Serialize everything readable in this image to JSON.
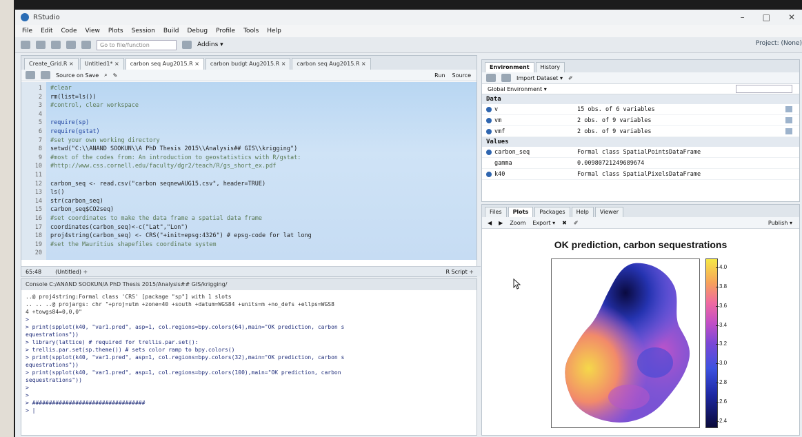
{
  "window": {
    "title": "RStudio",
    "controls": [
      "–",
      "□",
      "✕"
    ]
  },
  "menu": [
    "File",
    "Edit",
    "Code",
    "View",
    "Plots",
    "Session",
    "Build",
    "Debug",
    "Profile",
    "Tools",
    "Help"
  ],
  "toolbar": {
    "goto_placeholder": "Go to file/function",
    "addins": "Addins ▾",
    "project": "Project: (None)"
  },
  "editor": {
    "tabs": [
      "Create_Grid.R ×",
      "Untitled1* ×",
      "carbon seq Aug2015.R ×",
      "carbon budgt Aug2015.R ×",
      "carbon seq Aug2015.R ×"
    ],
    "source_on_save": "Source on Save",
    "run": "Run",
    "source": "Source",
    "lines": [
      {
        "n": "1",
        "t": "#clear",
        "k": "comment"
      },
      {
        "n": "2",
        "t": "rm(list=ls())",
        "k": "plain"
      },
      {
        "n": "3",
        "t": "#control, clear workspace",
        "k": "comment"
      },
      {
        "n": "4",
        "t": "",
        "k": "plain"
      },
      {
        "n": "5",
        "t": "require(sp)",
        "k": "kw"
      },
      {
        "n": "6",
        "t": "require(gstat)",
        "k": "kw"
      },
      {
        "n": "7",
        "t": "#set your own working directory",
        "k": "comment"
      },
      {
        "n": "8",
        "t": "setwd(\"C:\\\\ANAND SOOKUN\\\\A PhD Thesis 2015\\\\Analysis## GIS\\\\krigging\")",
        "k": "plain"
      },
      {
        "n": "9",
        "t": "#most of the codes from: An introduction to geostatistics with R/gstat:",
        "k": "comment"
      },
      {
        "n": "10",
        "t": "#http://www.css.cornell.edu/faculty/dgr2/teach/R/gs_short_ex.pdf",
        "k": "comment"
      },
      {
        "n": "11",
        "t": "",
        "k": "plain"
      },
      {
        "n": "12",
        "t": "carbon_seq <- read.csv(\"carbon seqnewAUG15.csv\", header=TRUE)",
        "k": "plain"
      },
      {
        "n": "13",
        "t": "ls()",
        "k": "plain"
      },
      {
        "n": "14",
        "t": "str(carbon_seq)",
        "k": "plain"
      },
      {
        "n": "15",
        "t": "carbon_seq$CO2seq)",
        "k": "plain"
      },
      {
        "n": "16",
        "t": "#set coordinates to make the data frame a spatial data frame",
        "k": "comment"
      },
      {
        "n": "17",
        "t": "coordinates(carbon_seq)<-c(\"Lat\",\"Lon\")",
        "k": "plain"
      },
      {
        "n": "18",
        "t": "proj4string(carbon_seq) <- CRS(\"+init=epsg:4326\") # epsg-code for lat long",
        "k": "plain"
      },
      {
        "n": "19",
        "t": "#set the Mauritius shapefiles coordinate system",
        "k": "comment"
      },
      {
        "n": "20",
        "t": "",
        "k": "plain"
      }
    ],
    "status_pos": "65:48",
    "status_ctx": "(Untitled) ÷",
    "status_type": "R Script ÷"
  },
  "console": {
    "header": "Console C:/ANAND SOOKUN/A PhD Thesis 2015/Analysis## GIS/krigging/",
    "lines": [
      {
        "t": "  ..@ proj4string:Formal class 'CRS' [package \"sp\"] with 1 slots",
        "k": "out"
      },
      {
        "t": "  .. .. ..@ projargs: chr \"+proj=utm +zone=40 +south +datum=WGS84 +units=m +no_defs +ellps=WGS8",
        "k": "out"
      },
      {
        "t": "4 +towgs84=0,0,0\"",
        "k": "out"
      },
      {
        "t": ">",
        "k": "in"
      },
      {
        "t": "> print(spplot(k40, \"var1.pred\", asp=1, col.regions=bpy.colors(64),main=\"OK prediction, carbon s",
        "k": "in"
      },
      {
        "t": "equestrations\"))",
        "k": "in"
      },
      {
        "t": "> library(lattice) # required for trellis.par.set():",
        "k": "in"
      },
      {
        "t": "> trellis.par.set(sp.theme()) # sets color ramp to bpy.colors()",
        "k": "in"
      },
      {
        "t": "> print(spplot(k40, \"var1.pred\", asp=1, col.regions=bpy.colors(32),main=\"OK prediction, carbon s",
        "k": "in"
      },
      {
        "t": "equestrations\"))",
        "k": "in"
      },
      {
        "t": "> print(spplot(k40, \"var1.pred\", asp=1, col.regions=bpy.colors(100),main=\"OK prediction, carbon",
        "k": "in"
      },
      {
        "t": " sequestrations\"))",
        "k": "in"
      },
      {
        "t": ">",
        "k": "in"
      },
      {
        "t": ">",
        "k": "in"
      },
      {
        "t": "> ##################################",
        "k": "in"
      },
      {
        "t": "> |",
        "k": "in"
      }
    ]
  },
  "environment": {
    "tabs": [
      "Environment",
      "History"
    ],
    "import": "Import Dataset ▾",
    "scope": "Global Environment ▾",
    "data_label": "Data",
    "values_label": "Values",
    "data": [
      {
        "name": "v",
        "value": "15 obs. of 6 variables"
      },
      {
        "name": "vm",
        "value": "2 obs. of 9 variables"
      },
      {
        "name": "vmf",
        "value": "2 obs. of 9 variables"
      }
    ],
    "values": [
      {
        "name": "carbon_seq",
        "value": "Formal class SpatialPointsDataFrame"
      },
      {
        "name": "gamma",
        "value": "0.00980721249689674"
      },
      {
        "name": "k40",
        "value": "Formal class SpatialPixelsDataFrame"
      }
    ]
  },
  "plots_pane": {
    "tabs": [
      "Files",
      "Plots",
      "Packages",
      "Help",
      "Viewer"
    ],
    "zoom": "Zoom",
    "export": "Export ▾",
    "publish": "Publish ▾",
    "title": "OK prediction, carbon sequestrations",
    "colorbar_ticks": [
      "4.0",
      "3.8",
      "3.6",
      "3.4",
      "3.2",
      "3.0",
      "2.8",
      "2.6",
      "2.4"
    ],
    "colorbar_range": [
      2.35,
      4.1
    ]
  }
}
